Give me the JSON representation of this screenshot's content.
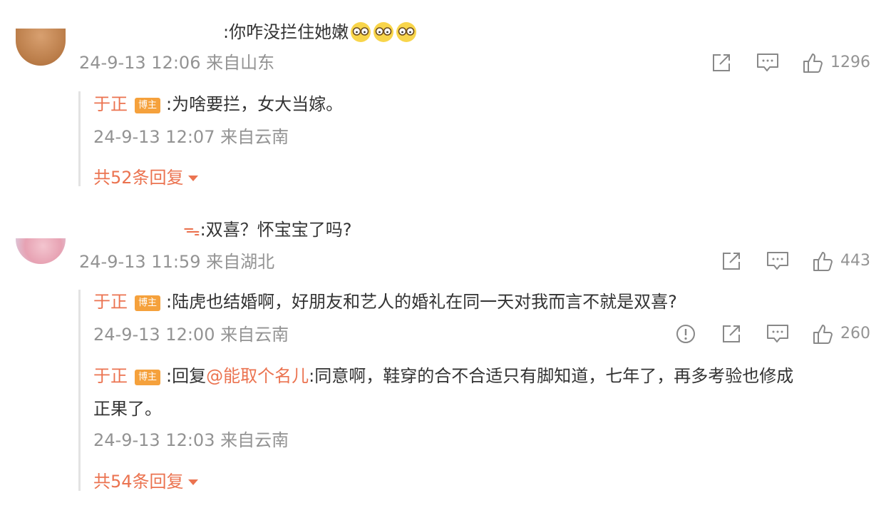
{
  "comments": [
    {
      "text": ":你咋没拦住她嫩",
      "emoji_icons": [
        "glasses-face-emoji",
        "glasses-face-emoji",
        "glasses-face-emoji"
      ],
      "meta": "24-9-13 12:06 来自山东",
      "like_count": "1296",
      "replies": [
        {
          "author": "于正",
          "badge": "博主",
          "text": ":为啥要拦，女大当嫁。",
          "meta": "24-9-13 12:07 来自云南"
        }
      ],
      "more_replies": "共52条回复"
    },
    {
      "text_prefix": "ᯓ",
      "text": ":双喜？怀宝宝了吗?",
      "meta": "24-9-13 11:59 来自湖北",
      "like_count": "443",
      "replies": [
        {
          "author": "于正",
          "badge": "博主",
          "text": ":陆虎也结婚啊，好朋友和艺人的婚礼在同一天对我而言不就是双喜?",
          "meta": "24-9-13 12:00 来自云南",
          "like_count": "260"
        },
        {
          "author": "于正",
          "badge": "博主",
          "reply_prefix": ":回复",
          "mention": "@能取个名儿",
          "text_line1": ":同意啊，鞋穿的合不合适只有脚知道，七年了，再多考验也修成",
          "text_line2": "正果了。",
          "meta": "24-9-13 12:03 来自云南"
        }
      ],
      "more_replies": "共54条回复"
    }
  ],
  "colors": {
    "accent": "#eb7350",
    "badge": "#f5a13c",
    "meta_gray": "#939393",
    "text": "#333333"
  }
}
